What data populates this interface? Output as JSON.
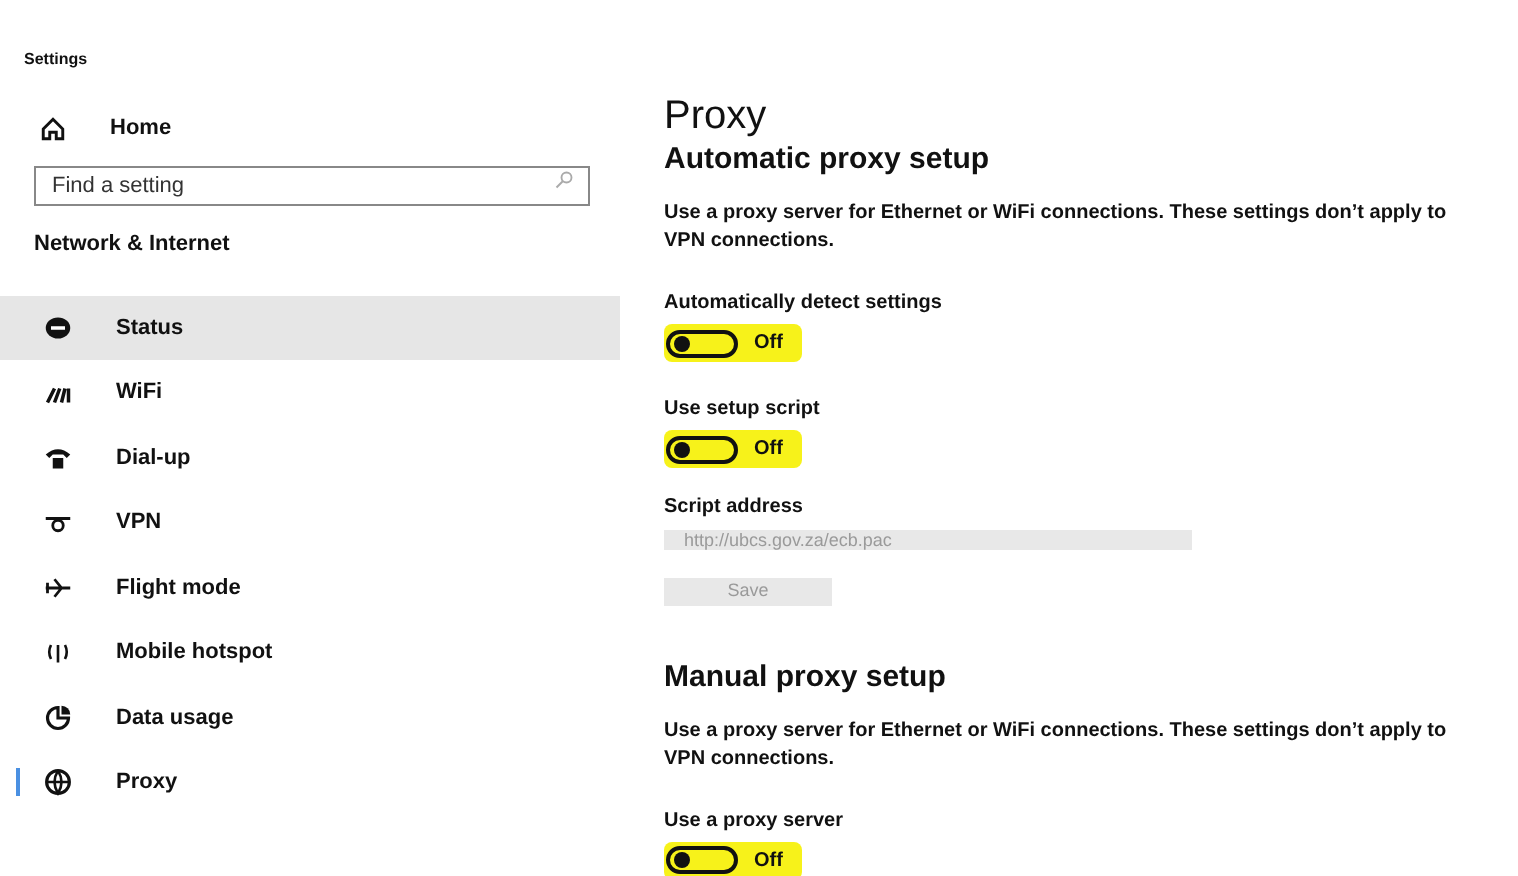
{
  "window": {
    "title": "Settings"
  },
  "sidebar": {
    "home": "Home",
    "search": {
      "placeholder": "Find a setting"
    },
    "section": "Network & Internet",
    "items": [
      {
        "label": "Status",
        "selected": false,
        "hovered": true
      },
      {
        "label": "WiFi",
        "selected": false,
        "hovered": false
      },
      {
        "label": "Dial-up",
        "selected": false,
        "hovered": false
      },
      {
        "label": "VPN",
        "selected": false,
        "hovered": false
      },
      {
        "label": "Flight mode",
        "selected": false,
        "hovered": false
      },
      {
        "label": "Mobile hotspot",
        "selected": false,
        "hovered": false
      },
      {
        "label": "Data usage",
        "selected": false,
        "hovered": false
      },
      {
        "label": "Proxy",
        "selected": true,
        "hovered": false
      }
    ]
  },
  "main": {
    "title": "Proxy",
    "sections": [
      {
        "heading": "Automatic proxy setup",
        "description": "Use a proxy server for Ethernet or WiFi connections. These settings don’t apply to VPN connections.",
        "controls": [
          {
            "kind": "toggle",
            "label": "Automatically detect settings",
            "on": false,
            "state_text": "Off",
            "highlighted": true
          },
          {
            "kind": "toggle",
            "label": "Use setup script",
            "on": false,
            "state_text": "Off",
            "highlighted": true
          },
          {
            "kind": "field",
            "label": "Script address",
            "value": "http://ubcs.gov.za/ecb.pac",
            "disabled": true
          },
          {
            "kind": "button",
            "label": "Save",
            "disabled": true
          }
        ]
      },
      {
        "heading": "Manual proxy setup",
        "description": "Use a proxy server for Ethernet or WiFi connections. These settings don’t apply to VPN connections.",
        "controls": [
          {
            "kind": "toggle",
            "label": "Use a proxy server",
            "on": false,
            "state_text": "Off",
            "highlighted": true
          }
        ]
      }
    ]
  }
}
